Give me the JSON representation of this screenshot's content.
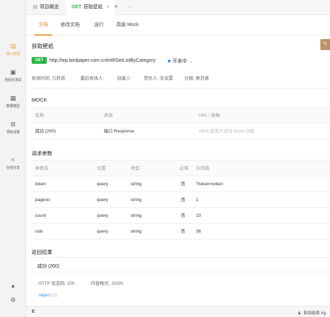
{
  "sidebar": {
    "items": [
      {
        "label": "接口管理",
        "icon": "api-doc-icon",
        "active": true
      },
      {
        "label": "自动化测试",
        "icon": "test-icon"
      },
      {
        "label": "数据模型",
        "icon": "model-icon"
      },
      {
        "label": "项目设置",
        "icon": "settings-box-icon"
      },
      {
        "label": "在线分享",
        "icon": "share-icon"
      }
    ],
    "bottom_icons": [
      "bell-icon",
      "gear-icon"
    ]
  },
  "tabs": {
    "overview": "项目概览",
    "active_method": "GET",
    "active_label": "获取壁纸",
    "close": "×",
    "add": "+",
    "more": "···"
  },
  "subtabs": [
    "文档",
    "修改文档",
    "运行",
    "高级 Mock"
  ],
  "api": {
    "title": "获取壁纸",
    "method": "GET",
    "url": "http://wp.birdpaper.com.cn/intf/GetListByCategory",
    "status": "开发中",
    "modified_time": "修改时间: 几秒前",
    "last_editor": "最后修改人:",
    "creator": "创建人:",
    "owner": "责任人: 未设置",
    "folder": "分组: 根目录"
  },
  "mock": {
    "section": "MOCK",
    "headers": [
      "名称",
      "来源",
      "URL / 参数"
    ],
    "rows": [
      [
        "成功 (200)",
        "接口 Response",
        "WEB 版暂不支持 Mock 功能"
      ]
    ]
  },
  "params": {
    "section": "请求参数",
    "headers": [
      "参数名",
      "位置",
      "类型",
      "必填",
      "示例值"
    ],
    "rows": [
      [
        "token",
        "query",
        "string",
        "否",
        "?token=token"
      ],
      [
        "pageno",
        "query",
        "string",
        "否",
        "1"
      ],
      [
        "count",
        "query",
        "string",
        "否",
        "10"
      ],
      [
        "cids",
        "query",
        "string",
        "否",
        "36"
      ]
    ]
  },
  "response": {
    "section": "返回结果",
    "tab": "成功 (200)",
    "http_status": "HTTP 状态码: 200",
    "content_type": "内容格式: JSON",
    "root_type": "object",
    "root_extra": "{0}"
  },
  "bottombar": {
    "auto_select": "自动选择 Ag"
  },
  "colors": {
    "accent": "#e8a33d",
    "get": "#27b648",
    "link": "#2a8fe8"
  }
}
